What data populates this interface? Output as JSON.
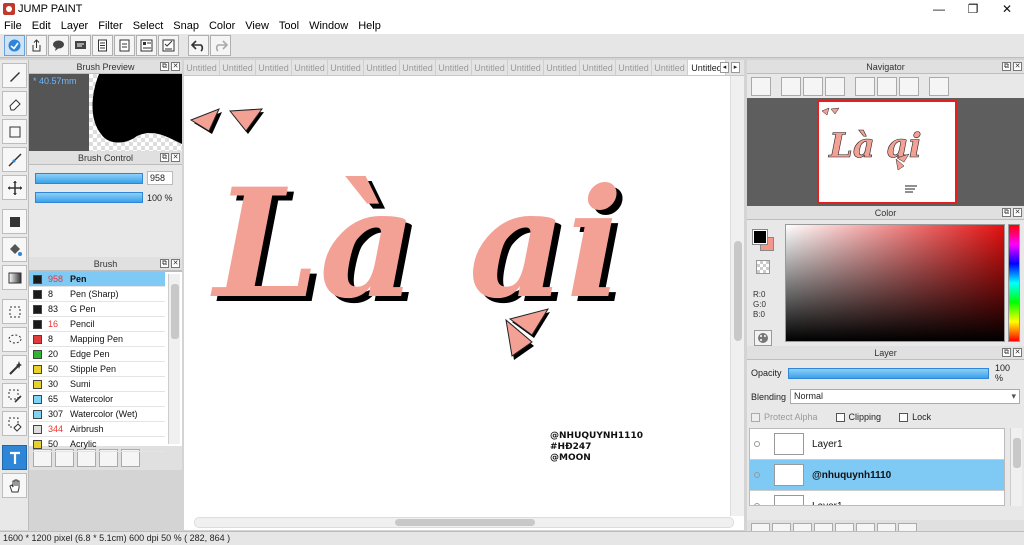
{
  "window": {
    "title": "JUMP PAINT",
    "controls": [
      "—",
      "❐",
      "✕"
    ]
  },
  "menu": [
    "File",
    "Edit",
    "Layer",
    "Filter",
    "Select",
    "Snap",
    "Color",
    "View",
    "Tool",
    "Window",
    "Help"
  ],
  "panels": {
    "brush_preview": {
      "title": "Brush Preview",
      "size": "* 40.57mm"
    },
    "brush_control": {
      "title": "Brush Control",
      "size_value": "958",
      "opacity_value": "100 %"
    },
    "brush": {
      "title": "Brush"
    },
    "navigator": {
      "title": "Navigator"
    },
    "color": {
      "title": "Color",
      "rgb": [
        "R:0",
        "G:0",
        "B:0"
      ],
      "fg": "#000000",
      "bg": "#f4978b"
    },
    "layer": {
      "title": "Layer",
      "opacity_label": "Opacity",
      "opacity_value": "100 %",
      "blending_label": "Blending",
      "blending_value": "Normal",
      "protect_alpha": "Protect Alpha",
      "clipping": "Clipping",
      "lock": "Lock"
    }
  },
  "brushes": [
    {
      "num": "958",
      "name": "Pen",
      "color": "#1a1a1a",
      "red": true,
      "selected": true
    },
    {
      "num": "8",
      "name": "Pen (Sharp)",
      "color": "#1a1a1a",
      "red": false
    },
    {
      "num": "83",
      "name": "G Pen",
      "color": "#1a1a1a",
      "red": false
    },
    {
      "num": "16",
      "name": "Pencil",
      "color": "#1a1a1a",
      "red": true
    },
    {
      "num": "8",
      "name": "Mapping Pen",
      "color": "#e23b3b",
      "red": false
    },
    {
      "num": "20",
      "name": "Edge Pen",
      "color": "#2fb52f",
      "red": false
    },
    {
      "num": "50",
      "name": "Stipple Pen",
      "color": "#e8d22a",
      "red": false
    },
    {
      "num": "30",
      "name": "Sumi",
      "color": "#e8d22a",
      "red": false
    },
    {
      "num": "65",
      "name": "Watercolor",
      "color": "#7fd3f5",
      "red": false
    },
    {
      "num": "307",
      "name": "Watercolor (Wet)",
      "color": "#7fd3f5",
      "red": false
    },
    {
      "num": "344",
      "name": "Airbrush",
      "color": "#dddddd",
      "red": true
    },
    {
      "num": "50",
      "name": "Acrylic",
      "color": "#e8d22a",
      "red": false
    }
  ],
  "tabs": [
    "Untitled",
    "Untitled",
    "Untitled",
    "Untitled",
    "Untitled",
    "Untitled",
    "Untitled",
    "Untitled",
    "Untitled",
    "Untitled",
    "Untitled",
    "Untitled",
    "Untitled",
    "Untitled",
    "Untitled"
  ],
  "canvas": {
    "main_text": "Là ai",
    "credits": [
      "@NHUQUYNH1110",
      "#HĐ247",
      "@MOON"
    ]
  },
  "layers": [
    {
      "name": "Layer1",
      "selected": false
    },
    {
      "name": "@nhuquynh1110",
      "selected": true
    },
    {
      "name": "Layer1",
      "selected": false
    }
  ],
  "status": "1600 * 1200 pixel   (6.8 * 5.1cm)   600 dpi   50 %   ( 282, 864 )"
}
